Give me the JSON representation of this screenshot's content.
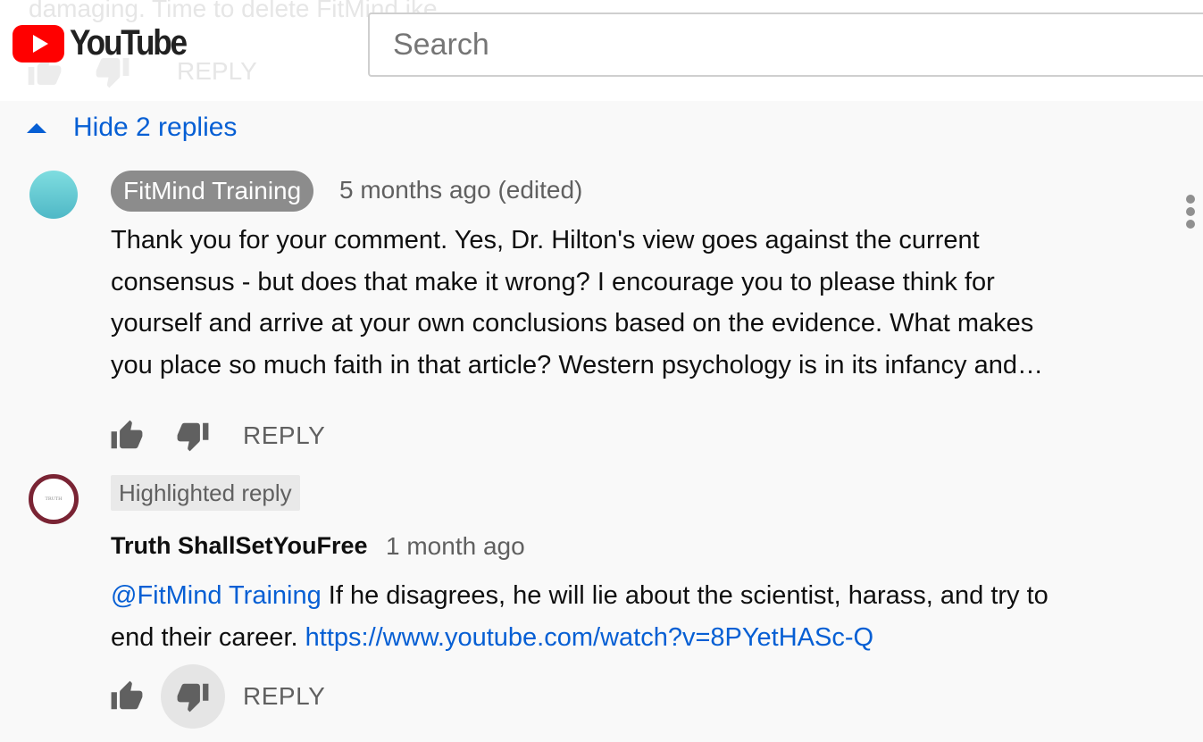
{
  "header": {
    "ghost_comment_text": "damaging. Time to delete FitMind ike",
    "ghost_reply_label": "REPLY",
    "logo_text": "YouTube",
    "search_placeholder": "Search"
  },
  "replies_toggle": {
    "label": "Hide 2 replies"
  },
  "replies": [
    {
      "author": "FitMind Training",
      "meta": "5 months ago (edited)",
      "text_lines": [
        "Thank you for your comment. Yes, Dr. Hilton's view goes against the current",
        "consensus - but does that make it wrong? I encourage you to please think for",
        "yourself and arrive at your own conclusions based on the evidence. What makes",
        "you place so much faith in that article? Western psychology is in its infancy and…"
      ],
      "reply_label": "REPLY"
    },
    {
      "badge": "Highlighted reply",
      "avatar_text": "TRUTH",
      "author": "Truth ShallSetYouFree",
      "meta": "1 month ago",
      "mention": "@FitMind Training",
      "text_part1": " If he disagrees, he will lie about the scientist, harass, and try to",
      "text_part2": "end their career. ",
      "link": "https://www.youtube.com/watch?v=8PYetHASc-Q",
      "reply_label": "REPLY"
    }
  ],
  "colors": {
    "youtube_red": "#ff0000",
    "link_blue": "#065fd4",
    "chip_gray": "#8c8c8c",
    "background": "#f9f9f9"
  }
}
